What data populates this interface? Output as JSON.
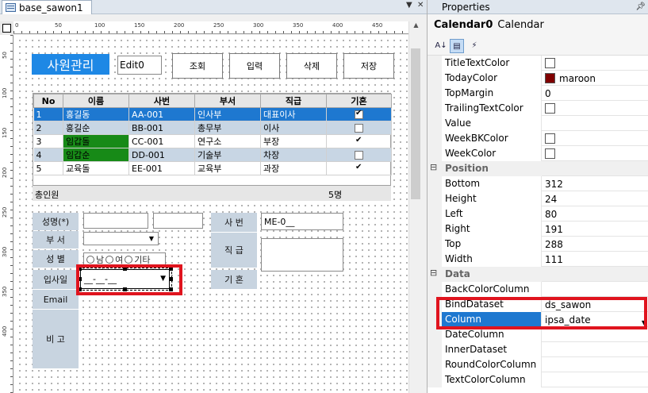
{
  "designer": {
    "tab_label": "base_sawon1",
    "ruler_top": [
      "0",
      "50",
      "100",
      "150",
      "200",
      "250",
      "300",
      "350",
      "400",
      "450"
    ],
    "ruler_left": [
      "50",
      "100",
      "150",
      "200",
      "250",
      "300",
      "350",
      "400"
    ]
  },
  "form": {
    "title": "사원관리",
    "edit_value": "Edit0",
    "buttons": [
      "조회",
      "입력",
      "삭제",
      "저장"
    ],
    "grid": {
      "headers": [
        "No",
        "이름",
        "사번",
        "부서",
        "직급",
        "기혼"
      ],
      "rows": [
        {
          "no": "1",
          "name": "홍길동",
          "id": "AA-001",
          "dept": "인사부",
          "rank": "대표이사",
          "married": true,
          "style": "sel"
        },
        {
          "no": "2",
          "name": "홍길순",
          "id": "BB-001",
          "dept": "총무부",
          "rank": "이사",
          "married": false,
          "style": "alt"
        },
        {
          "no": "3",
          "name": "임갑돌",
          "id": "CC-001",
          "dept": "연구소",
          "rank": "부장",
          "married": true,
          "style": "green"
        },
        {
          "no": "4",
          "name": "임갑순",
          "id": "DD-001",
          "dept": "기술부",
          "rank": "차장",
          "married": false,
          "style": "green-alt"
        },
        {
          "no": "5",
          "name": "교육돌",
          "id": "EE-001",
          "dept": "교육부",
          "rank": "과장",
          "married": true,
          "style": "plain"
        }
      ],
      "summary_label": "총인원",
      "summary_count": "5명"
    },
    "labels": {
      "name": "성명(*)",
      "dept": "부 서",
      "gender": "성 별",
      "hire": "입사일",
      "email": "Email",
      "memo": "비 고",
      "empno": "사 번",
      "rank": "직 급",
      "married": "기 혼"
    },
    "gender_options": [
      "남",
      "여",
      "기타"
    ],
    "empno_value": "ME-0__",
    "calendar_mask": "__-__-__"
  },
  "properties": {
    "panel_title": "Properties",
    "object_name": "Calendar0",
    "object_type": "Calendar",
    "rows": [
      {
        "kind": "prop",
        "name": "TitleTextColor",
        "value": "",
        "swatch": "#ffffff"
      },
      {
        "kind": "prop",
        "name": "TodayColor",
        "value": "maroon",
        "swatch": "#800000"
      },
      {
        "kind": "prop",
        "name": "TopMargin",
        "value": "0"
      },
      {
        "kind": "prop",
        "name": "TrailingTextColor",
        "value": "",
        "swatch": "#ffffff"
      },
      {
        "kind": "prop",
        "name": "Value",
        "value": ""
      },
      {
        "kind": "prop",
        "name": "WeekBKColor",
        "value": "",
        "swatch": "#ffffff"
      },
      {
        "kind": "prop",
        "name": "WeekColor",
        "value": "",
        "swatch": "#ffffff"
      },
      {
        "kind": "cat",
        "name": "Position"
      },
      {
        "kind": "prop",
        "name": "Bottom",
        "value": "312"
      },
      {
        "kind": "prop",
        "name": "Height",
        "value": "24"
      },
      {
        "kind": "prop",
        "name": "Left",
        "value": "80"
      },
      {
        "kind": "prop",
        "name": "Right",
        "value": "191"
      },
      {
        "kind": "prop",
        "name": "Top",
        "value": "288"
      },
      {
        "kind": "prop",
        "name": "Width",
        "value": "111"
      },
      {
        "kind": "cat",
        "name": "Data"
      },
      {
        "kind": "prop",
        "name": "BackColorColumn",
        "value": ""
      },
      {
        "kind": "prop",
        "name": "BindDataset",
        "value": "ds_sawon"
      },
      {
        "kind": "prop",
        "name": "Column",
        "value": "ipsa_date",
        "selected": true,
        "dropdown": true
      },
      {
        "kind": "prop",
        "name": "DateColumn",
        "value": ""
      },
      {
        "kind": "prop",
        "name": "InnerDataset",
        "value": ""
      },
      {
        "kind": "prop",
        "name": "RoundColorColumn",
        "value": ""
      },
      {
        "kind": "prop",
        "name": "TextColorColumn",
        "value": ""
      }
    ]
  },
  "colors": {
    "accent": "#1e88e5",
    "highlight_red": "#e0141e",
    "row_selected": "#1e78d0",
    "row_green": "#178a17",
    "maroon": "#800000"
  }
}
